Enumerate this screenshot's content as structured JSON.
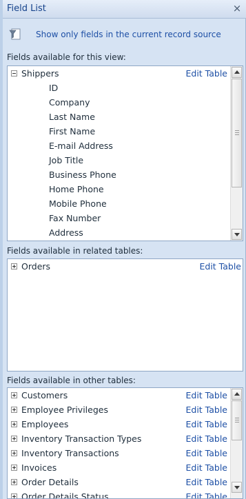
{
  "pane": {
    "title": "Field List",
    "close_glyph": "×"
  },
  "filter": {
    "icon": "filter-fields-icon",
    "label": "Show only fields in the current record source"
  },
  "sections": {
    "current": {
      "label": "Fields available for this view:",
      "table": {
        "name": "Shippers",
        "edit": "Edit Table",
        "expanded": true
      },
      "fields": [
        "ID",
        "Company",
        "Last Name",
        "First Name",
        "E-mail Address",
        "Job Title",
        "Business Phone",
        "Home Phone",
        "Mobile Phone",
        "Fax Number",
        "Address"
      ]
    },
    "related": {
      "label": "Fields available in related tables:",
      "tables": [
        {
          "name": "Orders",
          "edit": "Edit Table"
        }
      ]
    },
    "other": {
      "label": "Fields available in other tables:",
      "tables": [
        {
          "name": "Customers",
          "edit": "Edit Table"
        },
        {
          "name": "Employee Privileges",
          "edit": "Edit Table"
        },
        {
          "name": "Employees",
          "edit": "Edit Table"
        },
        {
          "name": "Inventory Transaction Types",
          "edit": "Edit Table"
        },
        {
          "name": "Inventory Transactions",
          "edit": "Edit Table"
        },
        {
          "name": "Invoices",
          "edit": "Edit Table"
        },
        {
          "name": "Order Details",
          "edit": "Edit Table"
        },
        {
          "name": "Order Details Status",
          "edit": "Edit Table"
        }
      ]
    }
  }
}
